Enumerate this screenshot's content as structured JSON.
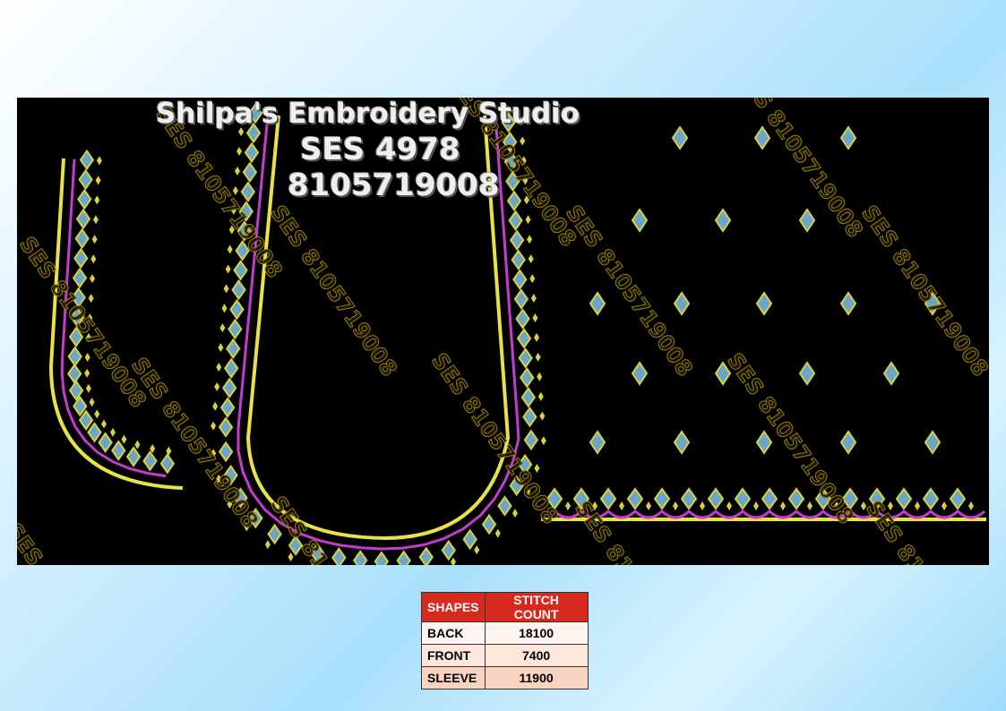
{
  "header": {
    "studio_name": "Shilpa's Embroidery Studio",
    "design_code": "SES  4978",
    "phone": "8105719008"
  },
  "watermark": "SES 8105719008",
  "colors": {
    "panel_bg": "#000000",
    "outline": "#e7e24a",
    "scallop": "#c43bd0",
    "motif_fill": "#6aa6cc",
    "motif_border": "#d9d23c",
    "table_header": "#d62a1e"
  },
  "stitch_table": {
    "headers": [
      "SHAPES",
      "STITCH COUNT"
    ],
    "rows": [
      {
        "shape": "BACK",
        "count": "18100"
      },
      {
        "shape": "FRONT",
        "count": "7400"
      },
      {
        "shape": "SLEEVE",
        "count": "11900"
      }
    ]
  }
}
